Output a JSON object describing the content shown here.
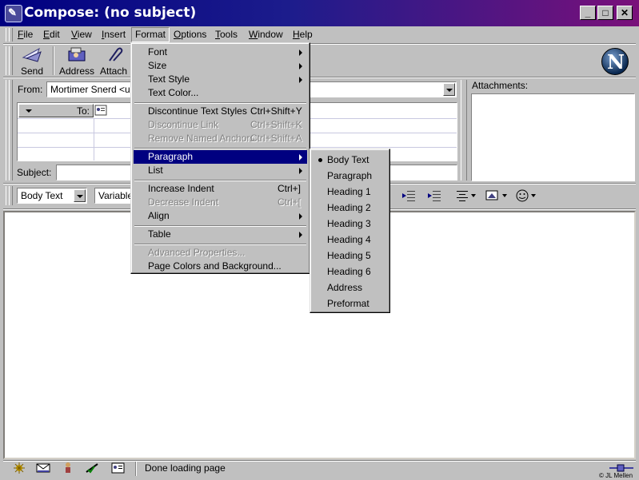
{
  "window": {
    "title": "Compose: (no subject)",
    "controls": {
      "minimize": "_",
      "maximize": "□",
      "close": "✕"
    }
  },
  "menubar": {
    "items": [
      {
        "label": "File",
        "ul": "F",
        "rest": "ile"
      },
      {
        "label": "Edit",
        "ul": "E",
        "rest": "dit"
      },
      {
        "label": "View",
        "ul": "V",
        "rest": "iew"
      },
      {
        "label": "Insert",
        "ul": "I",
        "rest": "nsert"
      },
      {
        "label": "Format",
        "ul": "",
        "rest": "Format"
      },
      {
        "label": "Options",
        "ul": "O",
        "rest": "ptions"
      },
      {
        "label": "Tools",
        "ul": "T",
        "rest": "ools"
      },
      {
        "label": "Window",
        "ul": "W",
        "rest": "indow"
      },
      {
        "label": "Help",
        "ul": "H",
        "rest": "elp"
      }
    ]
  },
  "toolbar": {
    "send": "Send",
    "address": "Address",
    "attach": "Attach"
  },
  "header": {
    "from_label": "From:",
    "from_value": "Mortimer Snerd <use",
    "to_label": "To:",
    "subject_label": "Subject:",
    "subject_value": "",
    "attachments_label": "Attachments:"
  },
  "format_toolbar": {
    "paragraph_style": "Body Text",
    "font": "Variable"
  },
  "format_menu": {
    "items": [
      {
        "label": "Font"
      },
      {
        "label": "Size"
      },
      {
        "label": "Text Style"
      },
      {
        "label": "Text Color..."
      },
      {
        "label": "Discontinue Text Styles",
        "shortcut": "Ctrl+Shift+Y"
      },
      {
        "label": "Discontinue Link",
        "shortcut": "Ctrl+Shift+K"
      },
      {
        "label": "Remove Named Anchors",
        "shortcut": "Ctrl+Shift+A"
      },
      {
        "label": "Paragraph"
      },
      {
        "label": "List"
      },
      {
        "label": "Increase Indent",
        "shortcut": "Ctrl+]"
      },
      {
        "label": "Decrease Indent",
        "shortcut": "Ctrl+["
      },
      {
        "label": "Align"
      },
      {
        "label": "Table"
      },
      {
        "label": "Advanced Properties..."
      },
      {
        "label": "Page Colors and Background..."
      }
    ]
  },
  "paragraph_submenu": {
    "items": [
      {
        "label": "Body Text"
      },
      {
        "label": "Paragraph"
      },
      {
        "label": "Heading 1"
      },
      {
        "label": "Heading 2"
      },
      {
        "label": "Heading 3"
      },
      {
        "label": "Heading 4"
      },
      {
        "label": "Heading 5"
      },
      {
        "label": "Heading 6"
      },
      {
        "label": "Address"
      },
      {
        "label": "Preformat"
      }
    ]
  },
  "statusbar": {
    "text": "Done loading page",
    "credit": "© JL Mellen"
  },
  "colors": {
    "menu_highlight": "#000080",
    "title_gradient_start": "#000080",
    "title_gradient_end": "#7a107a"
  }
}
